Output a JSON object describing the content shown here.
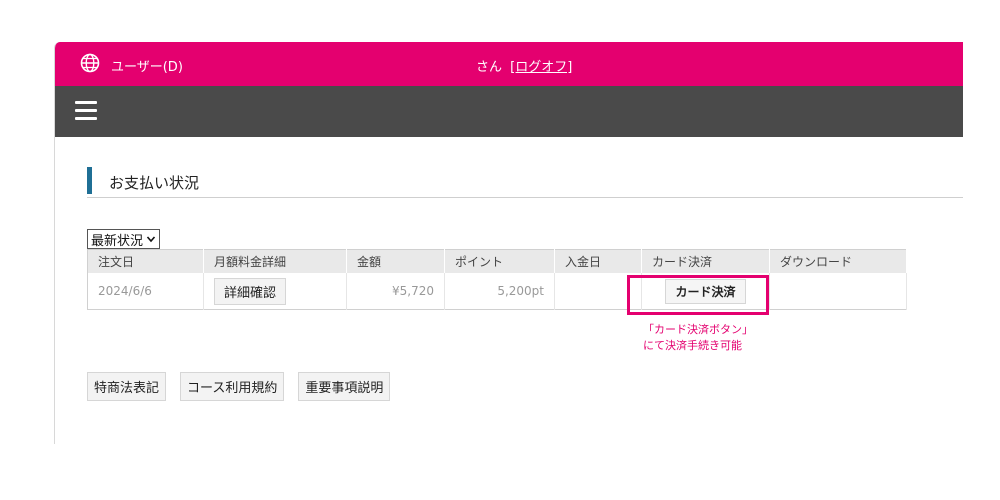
{
  "header": {
    "user_label": "ユーザー(D)",
    "greeting": "さん",
    "logout_label": "[ログオフ]",
    "accent_color": "#e4006f"
  },
  "menu": {
    "icon": "hamburger-icon"
  },
  "section": {
    "title": "お支払い状況"
  },
  "filter": {
    "selected": "最新状況"
  },
  "table": {
    "headers": [
      "注文日",
      "月額料金詳細",
      "金額",
      "ポイント",
      "入金日",
      "カード決済",
      "ダウンロード"
    ],
    "rows": [
      {
        "order_date": "2024/6/6",
        "detail_button": "詳細確認",
        "amount": "¥5,720",
        "points": "5,200pt",
        "payment_date": "",
        "card_button": "カード決済",
        "download": ""
      }
    ]
  },
  "note": {
    "line1": "「カード決済ボタン」",
    "line2": "にて決済手続き可能"
  },
  "footer": {
    "links": [
      "特商法表記",
      "コース利用規約",
      "重要事項説明"
    ]
  }
}
